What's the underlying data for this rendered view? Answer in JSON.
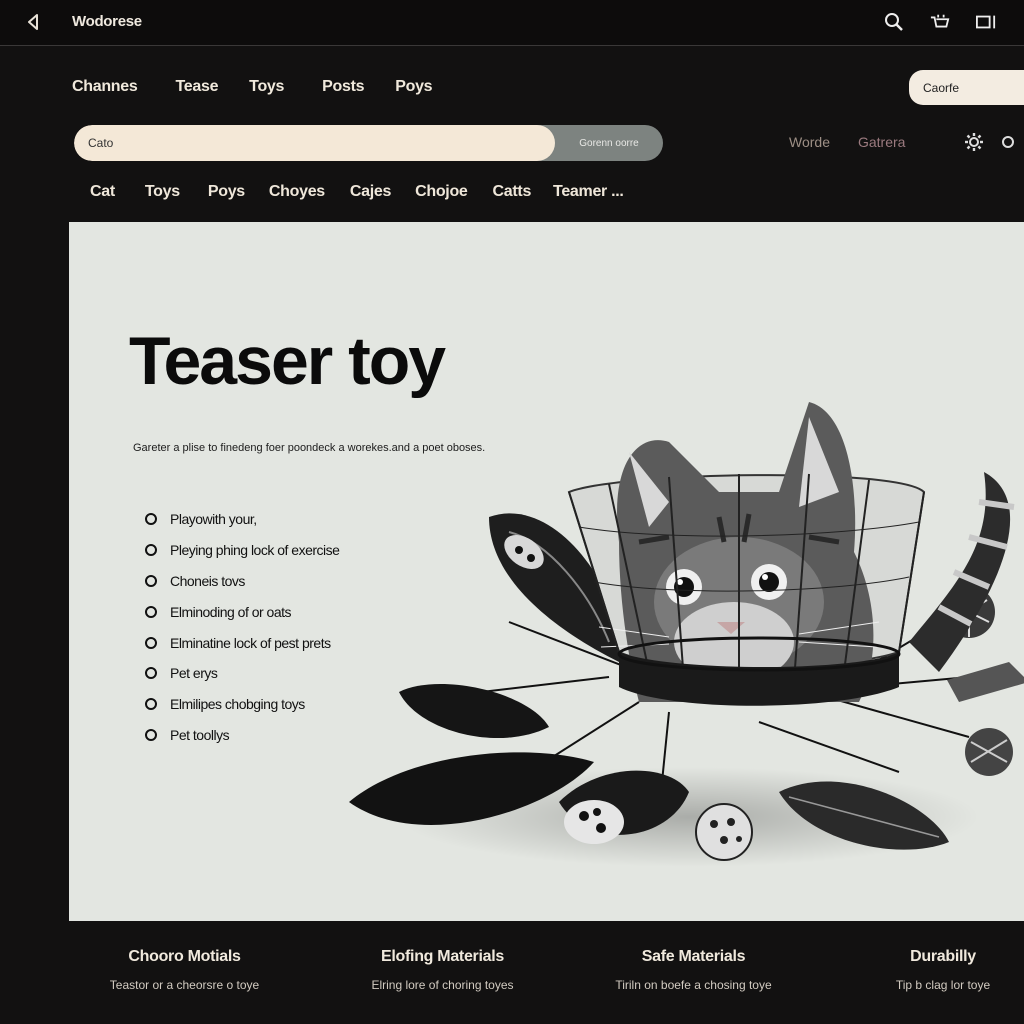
{
  "app": {
    "title": "Wodorese"
  },
  "topbar": {
    "icons": [
      "back-icon",
      "search-icon",
      "cart-icon",
      "window-icon"
    ]
  },
  "nav": {
    "items": [
      "Channes",
      "Tease",
      "Toys",
      "Posts",
      "Poys"
    ]
  },
  "account": {
    "label": "Caorfe"
  },
  "search": {
    "value": "Cato",
    "button_label": "Gorenn oorre"
  },
  "filters": {
    "items": [
      "Worde",
      "Gatrera"
    ]
  },
  "tags": {
    "items": [
      "Cat",
      "Toys",
      "Poys",
      "Choyes",
      "Cajes",
      "Chojoe",
      "Catts",
      "Teamer ..."
    ]
  },
  "hero": {
    "title": "Teaser toy",
    "subtitle": "Gareter a plise to finedeng foer poondeck a worekes.and a poet oboses.",
    "features": [
      "Playowith your,",
      "Pleying phing lock of exercise",
      "Choneis tovs",
      "Elminoding of or oats",
      "Elminatine lock of pest prets",
      "Pet erys",
      "Elmilipes chobging toys",
      "Pet toollys"
    ]
  },
  "footer": {
    "columns": [
      {
        "title": "Chooro Motials",
        "subtitle": "Teastor or a cheorsre o toye"
      },
      {
        "title": "Elofing Materials",
        "subtitle": "Elring lore of choring toyes"
      },
      {
        "title": "Safe Materials",
        "subtitle": "Tiriln on boefe a chosing toye"
      },
      {
        "title": "Durabilly",
        "subtitle": "Tip b clag lor toye"
      }
    ]
  },
  "colors": {
    "background": "#121111",
    "hero_bg": "#e3e6e1",
    "search_bg": "#f4e8d7",
    "search_button": "#7d8380"
  }
}
